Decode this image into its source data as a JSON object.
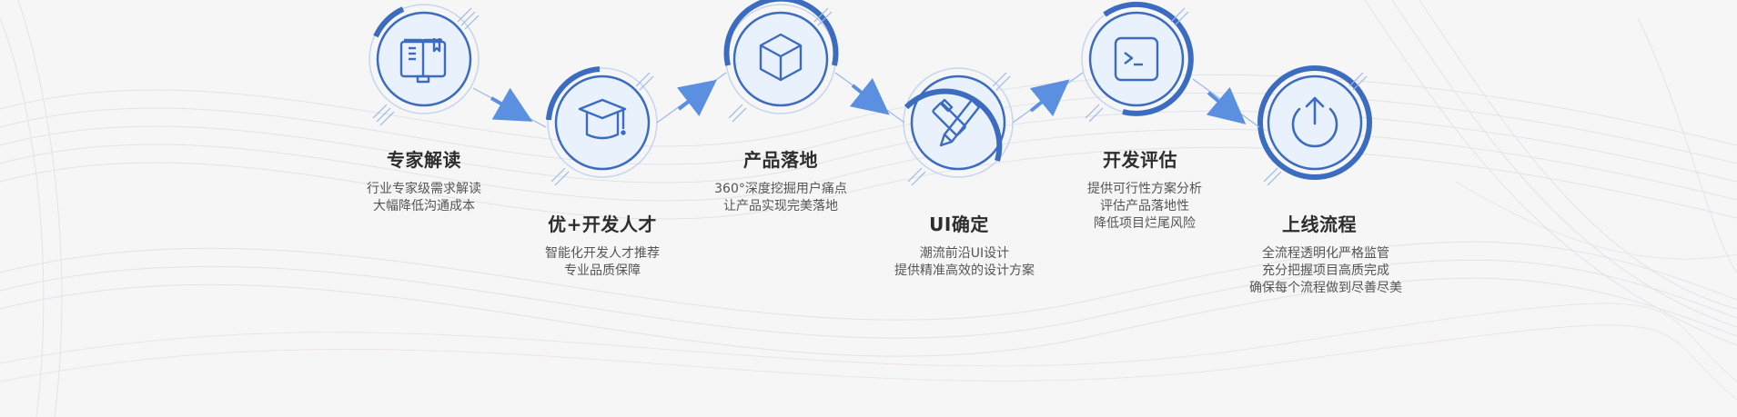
{
  "steps": [
    {
      "title": "专家解读",
      "icon": "book-icon",
      "lines": [
        "行业专家级需求解读",
        "大幅降低沟通成本"
      ]
    },
    {
      "title": "优+开发人才",
      "icon": "graduation-cap-icon",
      "lines": [
        "智能化开发人才推荐",
        "专业品质保障"
      ]
    },
    {
      "title": "产品落地",
      "icon": "cube-icon",
      "lines": [
        "360°深度挖掘用户痛点",
        "让产品实现完美落地"
      ]
    },
    {
      "title": "UI确定",
      "icon": "design-tools-icon",
      "lines": [
        "潮流前沿UI设计",
        "提供精准高效的设计方案"
      ]
    },
    {
      "title": "开发评估",
      "icon": "terminal-icon",
      "lines": [
        "提供可行性方案分析",
        "评估产品落地性",
        "降低项目烂尾风险"
      ]
    },
    {
      "title": "上线流程",
      "icon": "upload-icon",
      "lines": [
        "全流程透明化严格监管",
        "充分把握项目高质完成",
        "确保每个流程做到尽善尽美"
      ]
    }
  ],
  "colors": {
    "accent": "#3b6cc0",
    "light_ring": "#c5d6ef",
    "fill": "#e9f1fc",
    "arrow": "#5b8fe0"
  }
}
